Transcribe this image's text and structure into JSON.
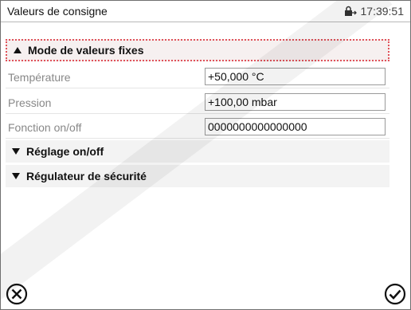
{
  "header": {
    "title": "Valeurs de consigne",
    "time": "17:39:51",
    "status_icon": "lock-icon"
  },
  "sections": {
    "fixed_mode": {
      "label": "Mode de valeurs fixes",
      "state": "expanded"
    },
    "onoff": {
      "label": "Réglage on/off",
      "state": "collapsed"
    },
    "safety": {
      "label": "Régulateur de sécurité",
      "state": "collapsed"
    }
  },
  "fields": [
    {
      "label": "Température",
      "value": "+50,000 °C"
    },
    {
      "label": "Pression",
      "value": "+100,00 mbar"
    },
    {
      "label": "Fonction on/off",
      "value": "0000000000000000"
    }
  ],
  "footer": {
    "cancel_icon": "cancel-icon",
    "confirm_icon": "check-icon"
  },
  "colors": {
    "focus_border": "#e0525a",
    "section_bg": "#f3f3f3"
  }
}
